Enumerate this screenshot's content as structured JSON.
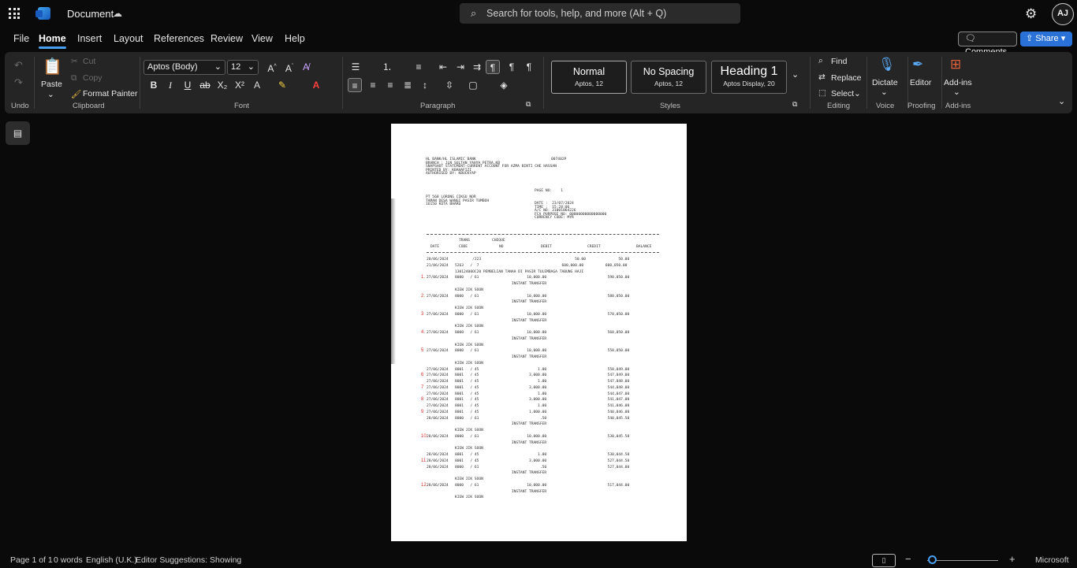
{
  "titlebar": {
    "doc_title": "Document",
    "search_placeholder": "Search for tools, help, and more (Alt + Q)",
    "avatar_initials": "AJ"
  },
  "tabs": [
    "File",
    "Home",
    "Insert",
    "Layout",
    "References",
    "Review",
    "View",
    "Help"
  ],
  "active_tab": "Home",
  "actions": {
    "comments": "Comments",
    "share": "Share"
  },
  "ribbon": {
    "undo_label": "Undo",
    "clipboard": {
      "paste": "Paste",
      "cut": "Cut",
      "copy": "Copy",
      "format_painter": "Format Painter",
      "label": "Clipboard"
    },
    "font": {
      "family": "Aptos (Body)",
      "size": "12",
      "label": "Font"
    },
    "paragraph": {
      "label": "Paragraph"
    },
    "styles": {
      "items": [
        {
          "name": "Normal",
          "sub": "Aptos, 12"
        },
        {
          "name": "No Spacing",
          "sub": "Aptos, 12"
        },
        {
          "name": "Heading 1",
          "sub": "Aptos Display, 20"
        }
      ],
      "label": "Styles"
    },
    "editing": {
      "find": "Find",
      "replace": "Replace",
      "select": "Select",
      "label": "Editing"
    },
    "voice": {
      "dictate": "Dictate",
      "label": "Voice"
    },
    "proofing": {
      "editor": "Editor",
      "label": "Proofing"
    },
    "addins": {
      "addins": "Add-ins",
      "label": "Add-ins"
    }
  },
  "statement": {
    "header_lines": [
      "HL BANK/HL ISLAMIC BANK",
      "BRANCH : JLN SULTAN YAHYA PETRA,KB",
      "SNAPSHOT STATEMENT-CURRENT ACCOUNT FOR AZMA BINTI CHE HASSAN",
      "PRINTED BY: KBAHAFIZI",
      "AUTHORISED BY: KBUCKYAP"
    ],
    "ref_no": "007402P",
    "page_no": "PAGE NO:    1",
    "address_lines": [
      "PT 568 LORONG CIKGU NOR",
      "TAMAN DESA WANGI PASIR TUMBOH",
      "16150 KOTA BHARU"
    ],
    "meta_lines": [
      "DATE :  23/07/2024",
      "TIME :  15:28:06",
      "A/C NO: 31001064226",
      "FCA PURPOSE NO: 00000000000000000",
      "CURRENCY CODE: MYR"
    ],
    "col_headers": {
      "trans": "TRANS",
      "cheque": "CHEQUE",
      "date": "DATE",
      "code": "CODE",
      "no": "NO",
      "debit": "DEBIT",
      "credit": "CREDIT",
      "balance": "BALANCE"
    },
    "rows": [
      "20/06/2024           /223                                           50.00               50.00",
      "21/06/2024   5263   /  7                                      600,000.00          600,050.00",
      "             13012400OC20 PEMBELIAN TANAH DI PASIR TULEMBAGA TABUNG HAJI",
      "27/06/2024   8000   / 61                      10,000.00                            590,050.00",
      "                                       INSTANT TRANSFER",
      "             KIEW JIK SOON",
      "27/06/2024   8000   / 61                      10,000.00                            580,050.00",
      "                                       INSTANT TRANSFER",
      "             KIEW JIK SOON",
      "27/06/2024   8000   / 61                      10,000.00                            570,050.00",
      "                                       INSTANT TRANSFER",
      "             KIEW JIK SOON",
      "27/06/2024   8000   / 61                      10,000.00                            560,050.00",
      "                                       INSTANT TRANSFER",
      "             KIEW JIK SOON",
      "27/06/2024   8000   / 61                      10,000.00                            550,050.00",
      "                                       INSTANT TRANSFER",
      "             KIEW JIK SOON",
      "27/06/2024   8001   / 45                           1.00                            550,049.00",
      "27/06/2024   8001   / 45                       3,000.00                            547,049.00",
      "27/06/2024   8001   / 45                           1.00                            547,048.00",
      "27/06/2024   8001   / 45                       3,000.00                            544,048.00",
      "27/06/2024   8001   / 45                           1.00                            544,047.00",
      "27/06/2024   8001   / 45                       3,000.00                            541,047.00",
      "27/06/2024   8001   / 45                           1.00                            541,046.00",
      "27/06/2024   8001   / 45                       1,000.00                            540,046.00",
      "28/06/2024   8000   / 61                            .50                            540,045.50",
      "                                       INSTANT TRANSFER",
      "             KIEW JIK SOON",
      "28/06/2024   8000   / 61                      10,000.00                            530,045.50",
      "                                       INSTANT TRANSFER",
      "             KIEW JIK SOON",
      "28/06/2024   8001   / 45                           1.00                            530,044.50",
      "28/06/2024   8001   / 45                       3,000.00                            527,044.50",
      "28/06/2024   8000   / 61                            .50                            527,044.00",
      "                                       INSTANT TRANSFER",
      "             KIEW JIK SOON",
      "28/06/2024   8000   / 61                      10,000.00                            517,044.00",
      "                                       INSTANT TRANSFER",
      "             KIEW JIK SOON"
    ],
    "margin_marks": [
      "1.",
      "2.",
      "3",
      "4.",
      "5",
      "6",
      "7",
      "8",
      "9",
      "10.",
      "11",
      "12."
    ]
  },
  "status": {
    "page": "Page 1 of 1",
    "words": "0 words",
    "language": "English (U.K.)",
    "editor": "Editor Suggestions: Showing",
    "brand": "Microsoft"
  }
}
